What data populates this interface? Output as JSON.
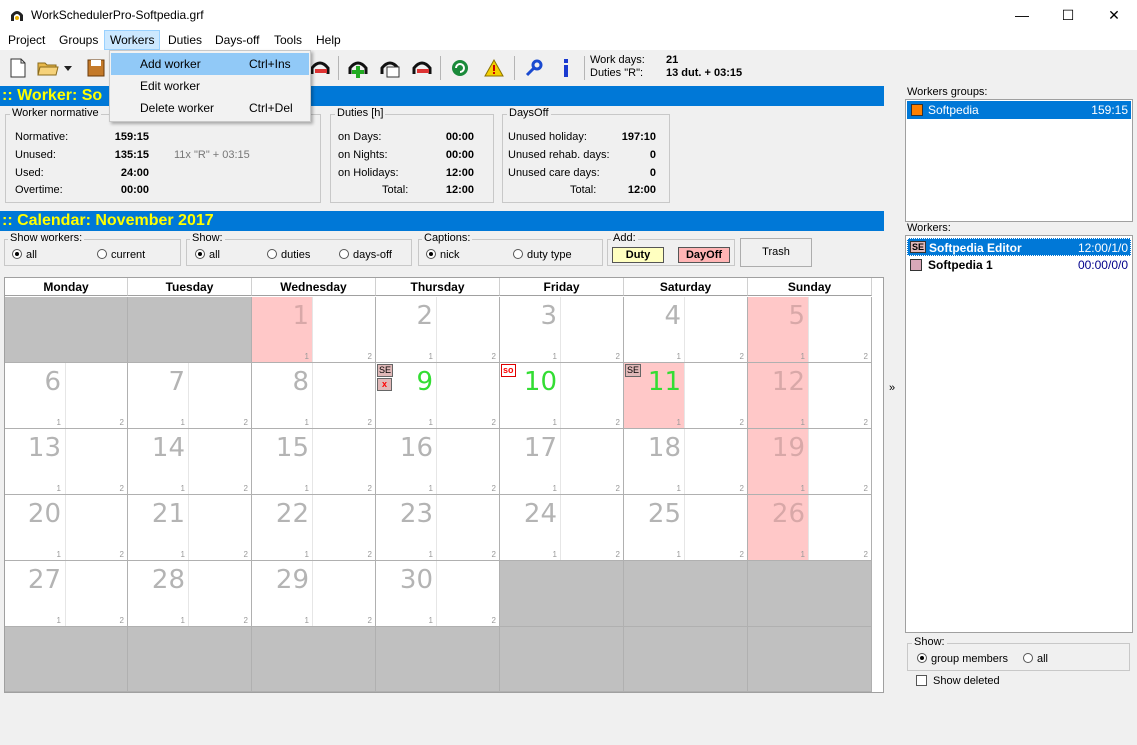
{
  "window": {
    "title": "WorkSchedulerPro-Softpedia.grf",
    "minimize": "—",
    "maximize": "☐",
    "close": "✕"
  },
  "menu": {
    "items": [
      "Project",
      "Groups",
      "Workers",
      "Duties",
      "Days-off",
      "Tools",
      "Help"
    ],
    "active": "Workers"
  },
  "workers_menu": {
    "items": [
      {
        "label": "Add worker",
        "shortcut": "Ctrl+Ins"
      },
      {
        "label": "Edit worker",
        "shortcut": ""
      },
      {
        "label": "Delete worker",
        "shortcut": "Ctrl+Del"
      }
    ]
  },
  "toolbar_info": {
    "work_days_label": "Work days:",
    "work_days_value": "21",
    "duties_label": "Duties \"R\":",
    "duties_value": "13 dut. + 03:15"
  },
  "worker_section": {
    "header": ":: Worker: So",
    "normative": {
      "title": "Worker normative",
      "rows": [
        {
          "label": "Normative:",
          "value": "159:15"
        },
        {
          "label": "Unused:",
          "value": "135:15"
        },
        {
          "label": "Used:",
          "value": "24:00"
        },
        {
          "label": "Overtime:",
          "value": "00:00"
        }
      ],
      "note": "11x \"R\" + 03:15"
    },
    "duties": {
      "title": "Duties [h]",
      "rows": [
        {
          "label": "on Days:",
          "value": "00:00"
        },
        {
          "label": "on Nights:",
          "value": "00:00"
        },
        {
          "label": "on Holidays:",
          "value": "12:00"
        },
        {
          "label": "Total:",
          "value": "12:00"
        }
      ]
    },
    "daysoff": {
      "title": "DaysOff",
      "rows": [
        {
          "label": "Unused holiday:",
          "value": "197:10"
        },
        {
          "label": "Unused rehab. days:",
          "value": "0"
        },
        {
          "label": "Unused care days:",
          "value": "0"
        },
        {
          "label": "Total:",
          "value": "12:00"
        }
      ]
    }
  },
  "calendar_section": {
    "header": ":: Calendar: November 2017",
    "show_workers": {
      "title": "Show workers:",
      "options": [
        "all",
        "current"
      ],
      "selected": "all"
    },
    "show": {
      "title": "Show:",
      "options": [
        "all",
        "duties",
        "days-off"
      ],
      "selected": "all"
    },
    "captions": {
      "title": "Captions:",
      "options": [
        "nick",
        "duty type"
      ],
      "selected": "nick"
    },
    "add": {
      "title": "Add:",
      "duty": "Duty",
      "dayoff": "DayOff"
    },
    "trash": "Trash",
    "weekdays": [
      "Monday",
      "Tuesday",
      "Wednesday",
      "Thursday",
      "Friday",
      "Saturday",
      "Sunday"
    ],
    "sub1": "1",
    "sub2": "2",
    "tags": {
      "se": "SE",
      "x": "x",
      "so": "so"
    }
  },
  "right_panel": {
    "groups_label": "Workers groups:",
    "groups": [
      {
        "name": "Softpedia",
        "value": "159:15",
        "color": "#ff8000"
      }
    ],
    "workers_label": "Workers:",
    "workers": [
      {
        "nick": "SE",
        "name": "Softpedia Editor",
        "value": "12:00/1/0"
      },
      {
        "nick": "",
        "name": "Softpedia 1",
        "value": "00:00/0/0"
      }
    ],
    "show_title": "Show:",
    "show_options": [
      "group members",
      "all"
    ],
    "show_selected": "group members",
    "show_deleted": "Show deleted",
    "splitter": "»"
  }
}
